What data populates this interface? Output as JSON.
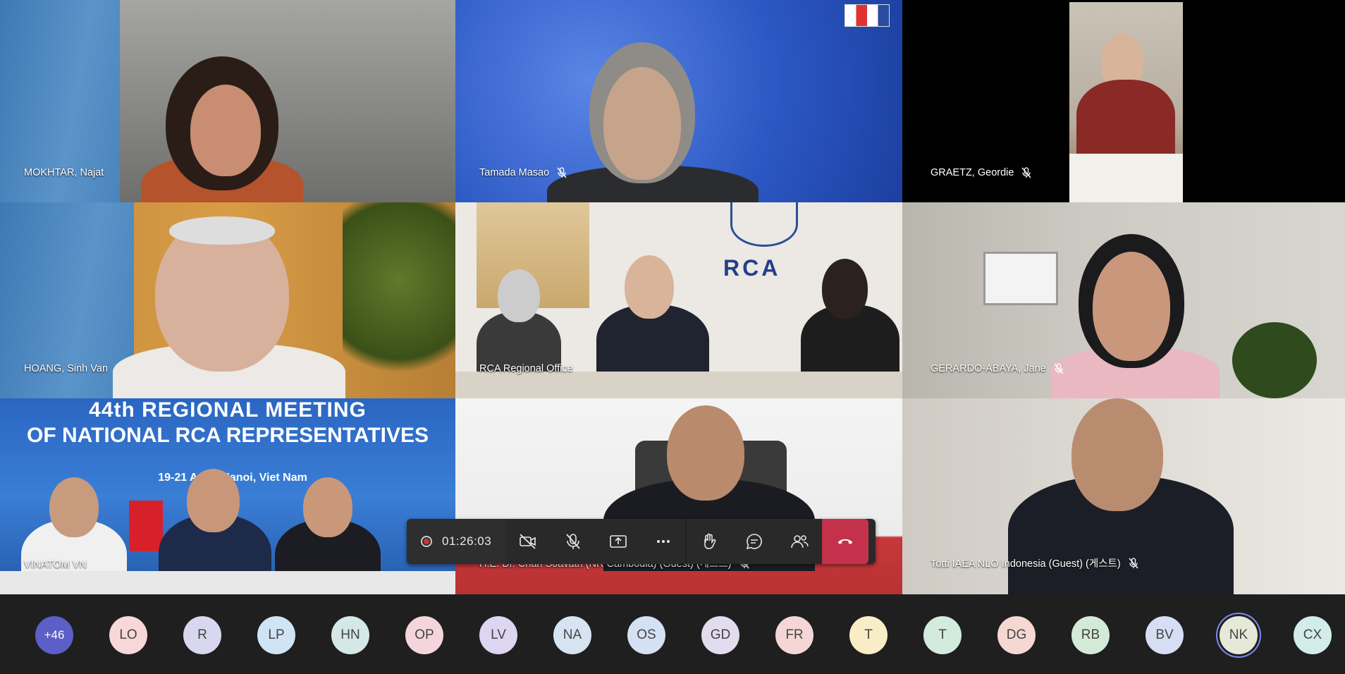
{
  "tiles": [
    {
      "name": "MOKHTAR, Najat",
      "muted": false
    },
    {
      "name": "Tamada Masao",
      "muted": true
    },
    {
      "name": "GRAETZ, Geordie",
      "muted": true
    },
    {
      "name": "HOANG, Sinh Van",
      "muted": false
    },
    {
      "name": "RCA Regional Office",
      "muted": false
    },
    {
      "name": "GERARDO-ABAYA, Jane",
      "muted": true
    },
    {
      "name": "VINATOM VN",
      "muted": false
    },
    {
      "name": "H.E. Dr. Chan Soavath (NR Cambodia) (Guest) (게스트)",
      "muted": true
    },
    {
      "name": "Totti IAEA NLO Indonesia (Guest) (게스트)",
      "muted": true
    }
  ],
  "banner": {
    "line1": "44th REGIONAL MEETING",
    "line2": "OF NATIONAL RCA REPRESENTATIVES",
    "line3": "19-21 April, Hanoi, Viet Nam"
  },
  "rca_sign": "RCA",
  "controls": {
    "timer": "01:26:03",
    "icons": [
      "camera-off-icon",
      "mic-off-icon",
      "share-screen-icon",
      "more-icon",
      "raise-hand-icon",
      "chat-icon",
      "participants-icon",
      "leave-call-icon"
    ]
  },
  "avatars": [
    {
      "initials": "+46",
      "color": "#5b5fc7"
    },
    {
      "initials": "LO",
      "color": "#f7d7d7"
    },
    {
      "initials": "R",
      "color": "#d8d7ef"
    },
    {
      "initials": "LP",
      "color": "#cfe4f5"
    },
    {
      "initials": "HN",
      "color": "#d5e8e8"
    },
    {
      "initials": "OP",
      "color": "#f5d5dc"
    },
    {
      "initials": "LV",
      "color": "#dcd6f1"
    },
    {
      "initials": "NA",
      "color": "#d6e4f2"
    },
    {
      "initials": "OS",
      "color": "#d4e1f3"
    },
    {
      "initials": "GD",
      "color": "#e2dcef"
    },
    {
      "initials": "FR",
      "color": "#f5d6d6"
    },
    {
      "initials": "T",
      "color": "#f8edc6"
    },
    {
      "initials": "T",
      "color": "#d2ebdd"
    },
    {
      "initials": "DG",
      "color": "#f5d8d2"
    },
    {
      "initials": "RB",
      "color": "#d4ead8"
    },
    {
      "initials": "BV",
      "color": "#d5def3"
    },
    {
      "initials": "NK",
      "color": "#e6e8d8"
    },
    {
      "initials": "CX",
      "color": "#d2ecea"
    }
  ]
}
